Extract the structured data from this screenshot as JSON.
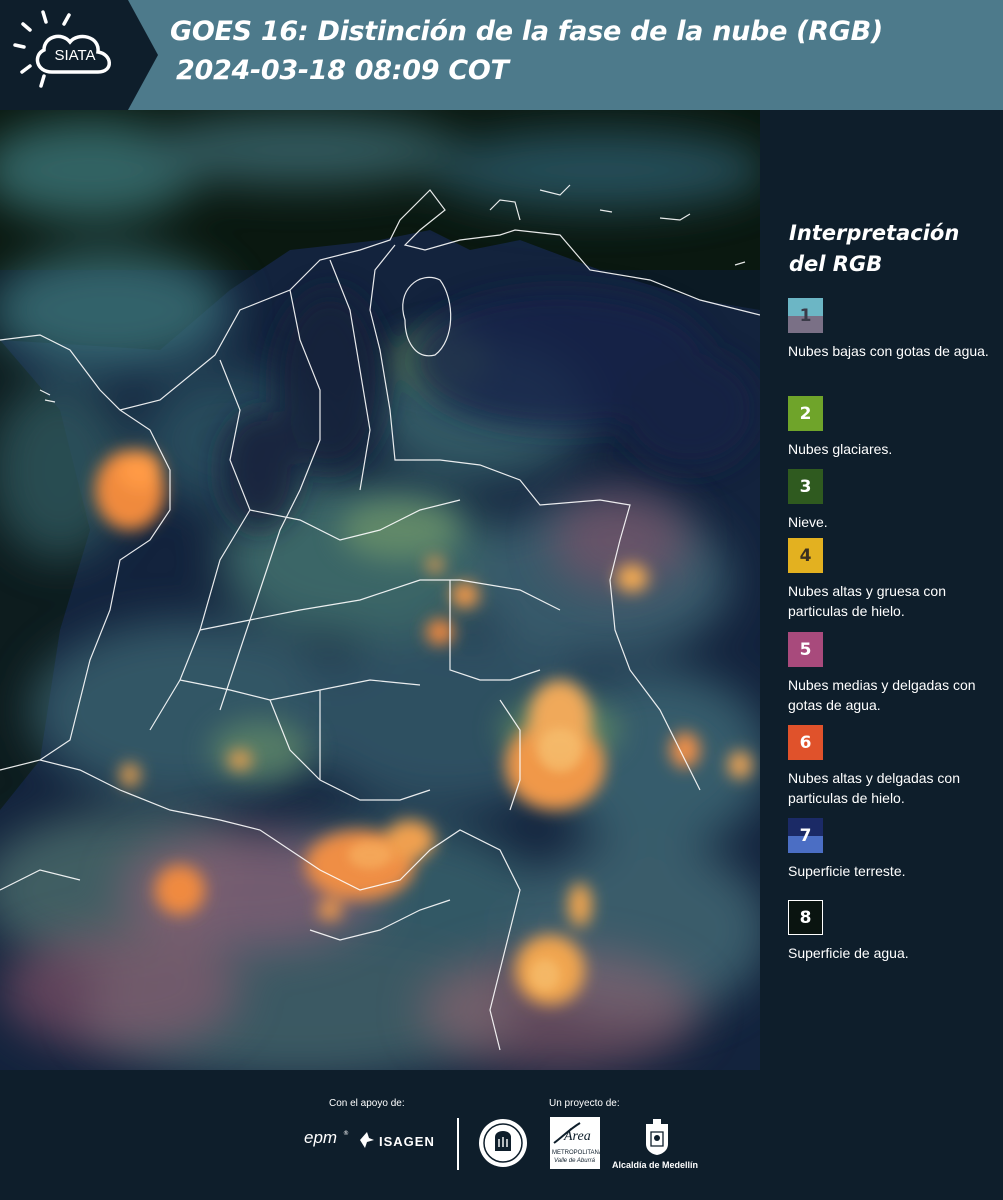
{
  "header": {
    "logo_text": "SIATA",
    "title_line1": "GOES 16: Distinción de la fase de la nube (RGB)",
    "title_line2": "2024-03-18 08:09 COT"
  },
  "legend": {
    "title_line1": "Interpretación",
    "title_line2": "del RGB",
    "items": [
      {
        "num": "1",
        "label": "Nubes bajas con gotas de agua.",
        "color_top": "#6cb6c5",
        "color_bottom": "#7a7086",
        "num_color": "#3a3a48"
      },
      {
        "num": "2",
        "label": "Nubes glaciares.",
        "color": "#6fa42a",
        "num_color": "#ffffff"
      },
      {
        "num": "3",
        "label": "Nieve.",
        "color": "#2f5a1f",
        "num_color": "#ffffff"
      },
      {
        "num": "4",
        "label": "Nubes altas y gruesa con particulas de hielo.",
        "color": "#e3b120",
        "num_color": "#3a3020"
      },
      {
        "num": "5",
        "label": "Nubes medias y delgadas con gotas de agua.",
        "color": "#a84a7c",
        "num_color": "#ffffff"
      },
      {
        "num": "6",
        "label": "Nubes altas y delgadas con particulas de hielo.",
        "color": "#e0522b",
        "num_color": "#ffffff"
      },
      {
        "num": "7",
        "label": "Superficie terreste.",
        "color_top": "#1b2a66",
        "color_bottom": "#4b6ec4",
        "num_color": "#ffffff"
      },
      {
        "num": "8",
        "label": "Superficie de agua.",
        "color": "#0a1410",
        "num_color": "#ffffff",
        "border": "#ffffff"
      }
    ]
  },
  "footer": {
    "support_caption": "Con el apoyo de:",
    "project_caption": "Un proyecto de:",
    "sponsor_epm": "epm",
    "sponsor_isagen": "ISAGEN",
    "sponsor_area_line1": "Área",
    "sponsor_area_line2": "METROPOLITANA",
    "sponsor_area_line3": "Valle de Aburrá",
    "sponsor_alcaldia": "Alcaldía de Medellín"
  },
  "colors": {
    "header_bg": "#4d7a8b",
    "logo_bg": "#0e1e2b",
    "page_bg": "#0e1e2b",
    "map_dark": "#0b1a24",
    "cloud_orange": "#f08a3c",
    "cloud_cyan": "#5fa3a6",
    "border_line": "#ffffff"
  }
}
